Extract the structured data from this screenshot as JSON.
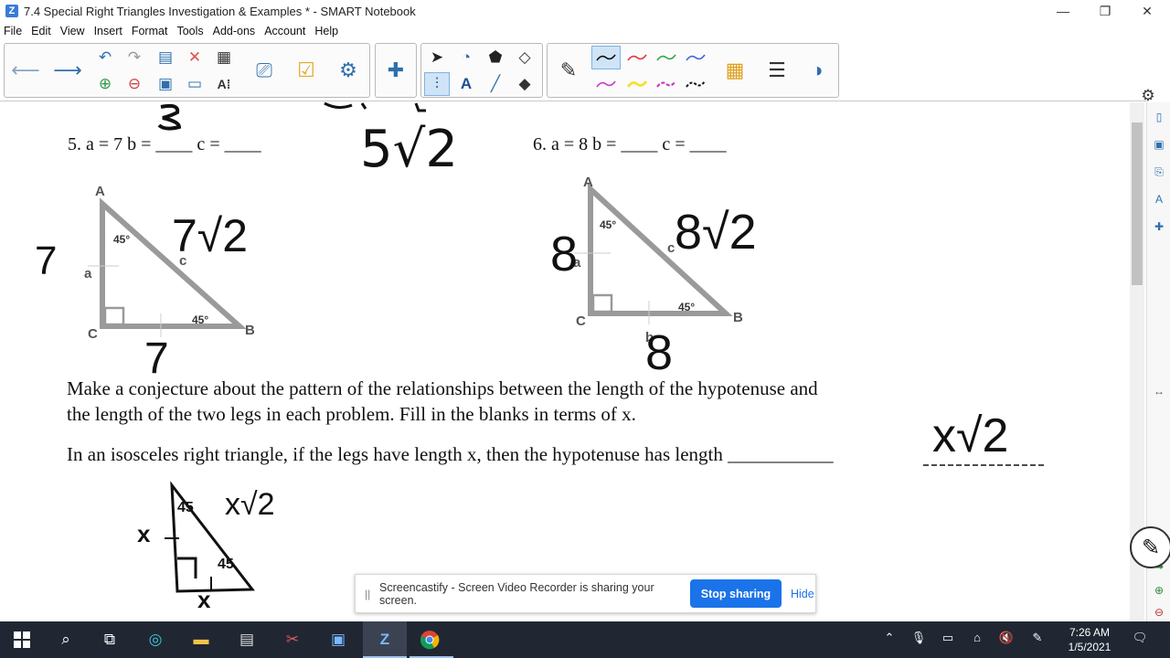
{
  "window": {
    "title": "7.4 Special Right Triangles Investigation & Examples * - SMART Notebook",
    "app_icon_glyph": "Z",
    "minimize_glyph": "—",
    "restore_glyph": "❐",
    "close_glyph": "✕"
  },
  "menu": [
    "File",
    "Edit",
    "View",
    "Insert",
    "Format",
    "Tools",
    "Add-ons",
    "Account",
    "Help"
  ],
  "colors": {
    "accent": "#2f6fae",
    "selected_bg": "#cfe4f7",
    "taskbar": "#202733",
    "share_button": "#1a73e8",
    "pen_black": "#111111",
    "pen_red": "#e0383e",
    "pen_green": "#2eaa48",
    "pen_blue": "#3d6bd8",
    "pen_magenta": "#c83ac8",
    "pen_yellow": "#f2e23a"
  },
  "toolbar_icons": {
    "back": "back-arrow-icon",
    "forward": "forward-arrow-icon",
    "undo": "undo-icon",
    "redo": "redo-icon",
    "delete": "delete-icon",
    "table": "table-icon",
    "pen": "pen-icon",
    "text": "text-tool-icon",
    "eraser": "eraser-icon",
    "fill": "fill-icon"
  },
  "problems": {
    "p5": {
      "text": "5.  a = 7     b = ____  c = ____",
      "answer_hand": "5√2"
    },
    "p6": {
      "text": "6. a = 8     b = ____  c = ____"
    }
  },
  "triangle1": {
    "vertex_a": "A",
    "vertex_b": "B",
    "vertex_c": "C",
    "side_a": "a",
    "side_c": "c",
    "angle_top": "45°",
    "angle_bottom": "45°",
    "hand_leg": "7",
    "hand_base": "7",
    "hand_hyp": "7√2"
  },
  "triangle2": {
    "vertex_a": "A",
    "vertex_b": "B",
    "vertex_c": "C",
    "side_a": "a",
    "side_b": "b",
    "side_c": "c",
    "angle_top": "45°",
    "angle_bottom": "45°",
    "hand_leg": "8",
    "hand_base": "8",
    "hand_hyp": "8√2"
  },
  "conjecture": {
    "line1": "Make a conjecture about the pattern of the relationships between the length of the hypotenuse and",
    "line2": "the length of the two legs in each problem.  Fill in the blanks in terms of x.",
    "line3": "In an isosceles right triangle, if the legs have length x, then the hypotenuse has length ___________",
    "hand_answer": "x√2"
  },
  "sketch": {
    "leg_label": "x",
    "base_label": "x",
    "hyp_label": "x√2",
    "angle_top": "45",
    "angle_bottom": "45"
  },
  "share_bar": {
    "message": "Screencastify - Screen Video Recorder is sharing your screen.",
    "stop_label": "Stop sharing",
    "hide_label": "Hide",
    "handle_glyph": "||"
  },
  "taskbar": {
    "time": "7:26 AM",
    "date": "1/5/2021"
  }
}
